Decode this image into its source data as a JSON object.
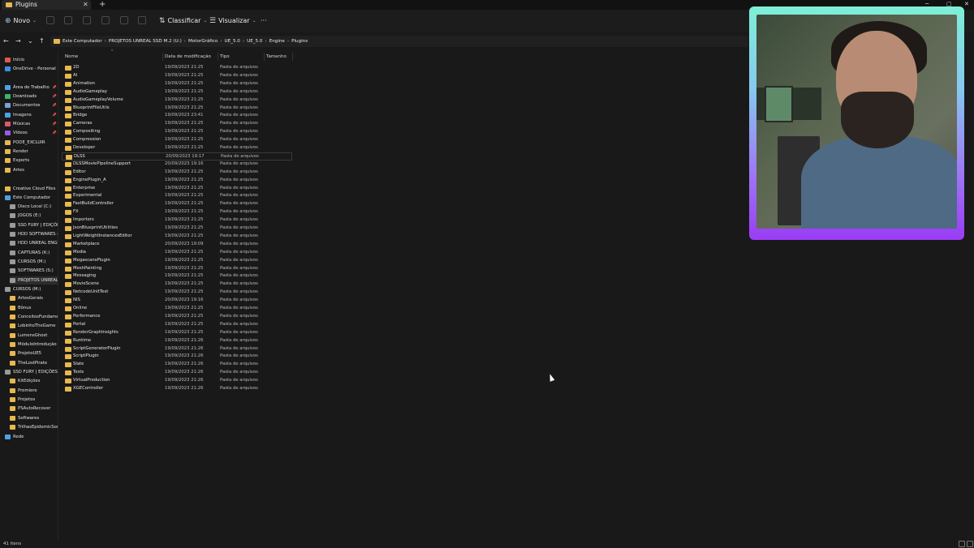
{
  "window": {
    "tab_title": "Plugins",
    "tab_close": "✕",
    "tab_add": "+",
    "minimize": "─",
    "maximize": "▢",
    "close": "✕"
  },
  "toolbar": {
    "new_label": "Novo",
    "sort_label": "Classificar",
    "view_label": "Visualizar",
    "more_label": "···"
  },
  "nav": {
    "back": "←",
    "forward": "→",
    "recent": "⌄",
    "up": "↑"
  },
  "breadcrumbs": [
    "Este Computador",
    "PROJETOS UNREAL SSD M.2 (U:)",
    "MotorGráfico",
    "UE_5.0",
    "UE_5.0",
    "Engine",
    "Plugins"
  ],
  "breadcrumb_sep": "›",
  "sidebar": {
    "items": [
      {
        "label": "Início",
        "icon": "home-icon",
        "color": "#e05a4a",
        "pinned": false
      },
      {
        "label": "OneDrive - Personal",
        "icon": "cloud-icon",
        "color": "#3b8ee8",
        "pinned": false
      },
      {
        "label": "Área de Trabalho",
        "icon": "desktop-icon",
        "color": "#4aa3e8",
        "pinned": true
      },
      {
        "label": "Downloads",
        "icon": "download-icon",
        "color": "#3bb36a",
        "pinned": true
      },
      {
        "label": "Documentos",
        "icon": "document-icon",
        "color": "#7d9fd6",
        "pinned": true
      },
      {
        "label": "Imagens",
        "icon": "image-icon",
        "color": "#4aa3e8",
        "pinned": true
      },
      {
        "label": "Músicas",
        "icon": "music-icon",
        "color": "#e0566a",
        "pinned": true
      },
      {
        "label": "Vídeos",
        "icon": "video-icon",
        "color": "#9b5ae0",
        "pinned": true
      },
      {
        "label": "PODE_EXCLUIR",
        "icon": "folder-icon",
        "color": "#e6b84d",
        "pinned": false
      },
      {
        "label": "Render",
        "icon": "folder-icon",
        "color": "#e6b84d",
        "pinned": false
      },
      {
        "label": "Exports",
        "icon": "folder-icon",
        "color": "#e6b84d",
        "pinned": false
      },
      {
        "label": "Artes",
        "icon": "folder-icon",
        "color": "#e6b84d",
        "pinned": false
      },
      {
        "label": "Creative Cloud Files",
        "icon": "creative-cloud-icon",
        "color": "#e6b84d",
        "pinned": false
      },
      {
        "label": "Este Computador",
        "icon": "computer-icon",
        "color": "#4aa3e8",
        "pinned": false
      },
      {
        "label": "Disco Local (C:)",
        "icon": "drive-icon",
        "color": "#9a9a9a",
        "pinned": false
      },
      {
        "label": "JOGOS (E:)",
        "icon": "drive-icon",
        "color": "#9a9a9a",
        "pinned": false
      },
      {
        "label": "SSD FURY | EDIÇÕE",
        "icon": "drive-icon",
        "color": "#9a9a9a",
        "pinned": false
      },
      {
        "label": "HDD SOFTWARES (",
        "icon": "drive-icon",
        "color": "#9a9a9a",
        "pinned": false
      },
      {
        "label": "HDD UNREAL ENGI",
        "icon": "drive-icon",
        "color": "#9a9a9a",
        "pinned": false
      },
      {
        "label": "CAPTURAS (K:)",
        "icon": "drive-icon",
        "color": "#9a9a9a",
        "pinned": false
      },
      {
        "label": "CURSOS (M:)",
        "icon": "drive-icon",
        "color": "#9a9a9a",
        "pinned": false
      },
      {
        "label": "SOFTWARES (S:)",
        "icon": "drive-icon",
        "color": "#9a9a9a",
        "pinned": false
      },
      {
        "label": "PROJETOS UNREAL",
        "icon": "drive-icon",
        "color": "#9a9a9a",
        "pinned": false
      },
      {
        "label": "CURSOS (M:)",
        "icon": "drive-icon",
        "color": "#9a9a9a",
        "pinned": false
      },
      {
        "label": "ArtesGerais",
        "icon": "folder-icon",
        "color": "#e6b84d",
        "pinned": false
      },
      {
        "label": "Bônus",
        "icon": "folder-icon",
        "color": "#e6b84d",
        "pinned": false
      },
      {
        "label": "ConceitosFundame",
        "icon": "folder-icon",
        "color": "#e6b84d",
        "pinned": false
      },
      {
        "label": "LobinhoTheGame",
        "icon": "folder-icon",
        "color": "#e6b84d",
        "pinned": false
      },
      {
        "label": "LumensGhost",
        "icon": "folder-icon",
        "color": "#e6b84d",
        "pinned": false
      },
      {
        "label": "MóduloIntrodução",
        "icon": "folder-icon",
        "color": "#e6b84d",
        "pinned": false
      },
      {
        "label": "ProjetoUE5",
        "icon": "folder-icon",
        "color": "#e6b84d",
        "pinned": false
      },
      {
        "label": "TheLostPirate",
        "icon": "folder-icon",
        "color": "#e6b84d",
        "pinned": false
      },
      {
        "label": "SSD FURY | EDIÇÕES",
        "icon": "drive-icon",
        "color": "#9a9a9a",
        "pinned": false
      },
      {
        "label": "KitEdições",
        "icon": "folder-icon",
        "color": "#e6b84d",
        "pinned": false
      },
      {
        "label": "Premiere",
        "icon": "folder-icon",
        "color": "#e6b84d",
        "pinned": false
      },
      {
        "label": "Projetos",
        "icon": "folder-icon",
        "color": "#e6b84d",
        "pinned": false
      },
      {
        "label": "PSAutoRecover",
        "icon": "folder-icon",
        "color": "#e6b84d",
        "pinned": false
      },
      {
        "label": "Softwares",
        "icon": "folder-icon",
        "color": "#e6b84d",
        "pinned": false
      },
      {
        "label": "TrilhasEpidemicSou",
        "icon": "folder-icon",
        "color": "#e6b84d",
        "pinned": false
      },
      {
        "label": "Rede",
        "icon": "network-icon",
        "color": "#4aa3e8",
        "pinned": false
      }
    ]
  },
  "columns": {
    "name": "Nome",
    "date": "Data de modificação",
    "type": "Tipo",
    "size": "Tamanho"
  },
  "files": [
    {
      "name": "2D",
      "date": "19/09/2023 21:25",
      "type": "Pasta de arquivos"
    },
    {
      "name": "AI",
      "date": "19/09/2023 21:25",
      "type": "Pasta de arquivos"
    },
    {
      "name": "Animation",
      "date": "19/09/2023 21:25",
      "type": "Pasta de arquivos"
    },
    {
      "name": "AudioGameplay",
      "date": "19/09/2023 21:25",
      "type": "Pasta de arquivos"
    },
    {
      "name": "AudioGameplayVolume",
      "date": "19/09/2023 21:25",
      "type": "Pasta de arquivos"
    },
    {
      "name": "BlueprintFileUtils",
      "date": "19/09/2023 21:25",
      "type": "Pasta de arquivos"
    },
    {
      "name": "Bridge",
      "date": "19/09/2023 23:41",
      "type": "Pasta de arquivos"
    },
    {
      "name": "Cameras",
      "date": "19/09/2023 21:25",
      "type": "Pasta de arquivos"
    },
    {
      "name": "Compositing",
      "date": "19/09/2023 21:25",
      "type": "Pasta de arquivos"
    },
    {
      "name": "Compression",
      "date": "19/09/2023 21:25",
      "type": "Pasta de arquivos"
    },
    {
      "name": "Developer",
      "date": "19/09/2023 21:25",
      "type": "Pasta de arquivos"
    },
    {
      "name": "DLSS",
      "date": "20/09/2023 19:17",
      "type": "Pasta de arquivos"
    },
    {
      "name": "DLSSMoviePipelineSupport",
      "date": "20/09/2023 19:16",
      "type": "Pasta de arquivos"
    },
    {
      "name": "Editor",
      "date": "19/09/2023 21:25",
      "type": "Pasta de arquivos"
    },
    {
      "name": "EnginePlugin_A",
      "date": "19/09/2023 21:25",
      "type": "Pasta de arquivos"
    },
    {
      "name": "Enterprise",
      "date": "19/09/2023 21:25",
      "type": "Pasta de arquivos"
    },
    {
      "name": "Experimental",
      "date": "19/09/2023 21:25",
      "type": "Pasta de arquivos"
    },
    {
      "name": "FastBuildController",
      "date": "19/09/2023 21:25",
      "type": "Pasta de arquivos"
    },
    {
      "name": "FX",
      "date": "19/09/2023 21:25",
      "type": "Pasta de arquivos"
    },
    {
      "name": "Importers",
      "date": "19/09/2023 21:25",
      "type": "Pasta de arquivos"
    },
    {
      "name": "JsonBlueprintUtilities",
      "date": "19/09/2023 21:25",
      "type": "Pasta de arquivos"
    },
    {
      "name": "LightWeightInstancesEditor",
      "date": "19/09/2023 21:25",
      "type": "Pasta de arquivos"
    },
    {
      "name": "Marketplace",
      "date": "20/09/2023 19:09",
      "type": "Pasta de arquivos"
    },
    {
      "name": "Media",
      "date": "19/09/2023 21:25",
      "type": "Pasta de arquivos"
    },
    {
      "name": "MegascansPlugin",
      "date": "19/09/2023 21:25",
      "type": "Pasta de arquivos"
    },
    {
      "name": "MeshPainting",
      "date": "19/09/2023 21:25",
      "type": "Pasta de arquivos"
    },
    {
      "name": "Messaging",
      "date": "19/09/2023 21:25",
      "type": "Pasta de arquivos"
    },
    {
      "name": "MovieScene",
      "date": "19/09/2023 21:25",
      "type": "Pasta de arquivos"
    },
    {
      "name": "NetcodeUnitTest",
      "date": "19/09/2023 21:25",
      "type": "Pasta de arquivos"
    },
    {
      "name": "NIS",
      "date": "20/09/2023 19:16",
      "type": "Pasta de arquivos"
    },
    {
      "name": "Online",
      "date": "19/09/2023 21:25",
      "type": "Pasta de arquivos"
    },
    {
      "name": "Performance",
      "date": "19/09/2023 21:25",
      "type": "Pasta de arquivos"
    },
    {
      "name": "Portal",
      "date": "19/09/2023 21:25",
      "type": "Pasta de arquivos"
    },
    {
      "name": "RenderGraphInsights",
      "date": "19/09/2023 21:25",
      "type": "Pasta de arquivos"
    },
    {
      "name": "Runtime",
      "date": "19/09/2023 21:26",
      "type": "Pasta de arquivos"
    },
    {
      "name": "ScriptGeneratorPlugin",
      "date": "19/09/2023 21:26",
      "type": "Pasta de arquivos"
    },
    {
      "name": "ScriptPlugin",
      "date": "19/09/2023 21:26",
      "type": "Pasta de arquivos"
    },
    {
      "name": "Slate",
      "date": "19/09/2023 21:26",
      "type": "Pasta de arquivos"
    },
    {
      "name": "Tests",
      "date": "19/09/2023 21:26",
      "type": "Pasta de arquivos"
    },
    {
      "name": "VirtualProduction",
      "date": "19/09/2023 21:26",
      "type": "Pasta de arquivos"
    },
    {
      "name": "XGEController",
      "date": "19/09/2023 21:26",
      "type": "Pasta de arquivos"
    }
  ],
  "selected_file_index": 11,
  "status": {
    "item_count": "41 itens"
  }
}
